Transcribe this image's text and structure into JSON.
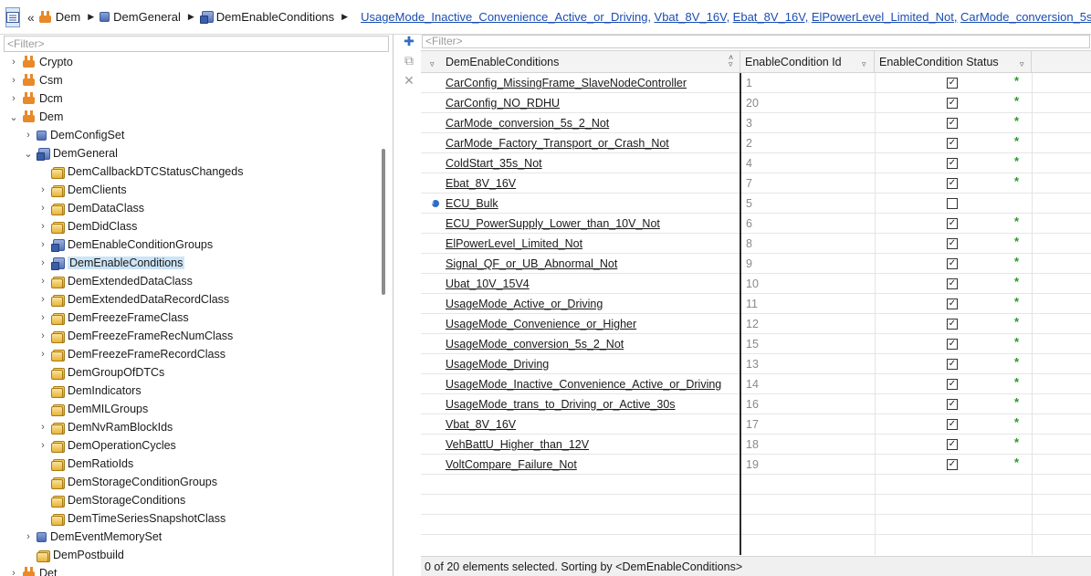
{
  "breadcrumb": {
    "back": "«",
    "segments": [
      "Dem",
      "DemGeneral",
      "DemEnableConditions"
    ],
    "links": [
      "UsageMode_Inactive_Convenience_Active_or_Driving,",
      "Vbat_8V_16V,",
      "Ebat_8V_16V,",
      "ElPowerLevel_Limited_Not,",
      "CarMode_conversion_5s_2_"
    ]
  },
  "tree": {
    "filter_placeholder": "<Filter>",
    "items": [
      {
        "label": "Crypto",
        "icon": "module-icon",
        "arrow": "›",
        "indent": 0
      },
      {
        "label": "Csm",
        "icon": "module-icon",
        "arrow": "›",
        "indent": 0
      },
      {
        "label": "Dcm",
        "icon": "module-icon",
        "arrow": "›",
        "indent": 0
      },
      {
        "label": "Dem",
        "icon": "module-icon",
        "arrow": "⌄",
        "indent": 0
      },
      {
        "label": "DemConfigSet",
        "icon": "container-icon",
        "arrow": "›",
        "indent": 1
      },
      {
        "label": "DemGeneral",
        "icon": "folder-lock-icon",
        "arrow": "⌄",
        "indent": 1
      },
      {
        "label": "DemCallbackDTCStatusChangeds",
        "icon": "folder-icon",
        "arrow": "",
        "indent": 2
      },
      {
        "label": "DemClients",
        "icon": "folder-icon",
        "arrow": "›",
        "indent": 2
      },
      {
        "label": "DemDataClass",
        "icon": "folder-icon",
        "arrow": "›",
        "indent": 2
      },
      {
        "label": "DemDidClass",
        "icon": "folder-icon",
        "arrow": "›",
        "indent": 2
      },
      {
        "label": "DemEnableConditionGroups",
        "icon": "folder-lock-icon",
        "arrow": "›",
        "indent": 2
      },
      {
        "label": "DemEnableConditions",
        "icon": "folder-lock-icon",
        "arrow": "›",
        "indent": 2,
        "selected": true
      },
      {
        "label": "DemExtendedDataClass",
        "icon": "folder-icon",
        "arrow": "›",
        "indent": 2
      },
      {
        "label": "DemExtendedDataRecordClass",
        "icon": "folder-icon",
        "arrow": "›",
        "indent": 2
      },
      {
        "label": "DemFreezeFrameClass",
        "icon": "folder-icon",
        "arrow": "›",
        "indent": 2
      },
      {
        "label": "DemFreezeFrameRecNumClass",
        "icon": "folder-icon",
        "arrow": "›",
        "indent": 2
      },
      {
        "label": "DemFreezeFrameRecordClass",
        "icon": "folder-icon",
        "arrow": "›",
        "indent": 2
      },
      {
        "label": "DemGroupOfDTCs",
        "icon": "folder-icon",
        "arrow": "",
        "indent": 2
      },
      {
        "label": "DemIndicators",
        "icon": "folder-icon",
        "arrow": "",
        "indent": 2
      },
      {
        "label": "DemMILGroups",
        "icon": "folder-icon",
        "arrow": "",
        "indent": 2
      },
      {
        "label": "DemNvRamBlockIds",
        "icon": "folder-icon",
        "arrow": "›",
        "indent": 2
      },
      {
        "label": "DemOperationCycles",
        "icon": "folder-icon",
        "arrow": "›",
        "indent": 2
      },
      {
        "label": "DemRatioIds",
        "icon": "folder-icon",
        "arrow": "",
        "indent": 2
      },
      {
        "label": "DemStorageConditionGroups",
        "icon": "folder-icon",
        "arrow": "",
        "indent": 2
      },
      {
        "label": "DemStorageConditions",
        "icon": "folder-icon",
        "arrow": "",
        "indent": 2
      },
      {
        "label": "DemTimeSeriesSnapshotClass",
        "icon": "folder-icon",
        "arrow": "",
        "indent": 2
      },
      {
        "label": "DemEventMemorySet",
        "icon": "container-icon",
        "arrow": "›",
        "indent": 1
      },
      {
        "label": "DemPostbuild",
        "icon": "folder-icon",
        "arrow": "",
        "indent": 1
      },
      {
        "label": "Det",
        "icon": "module-icon",
        "arrow": "›",
        "indent": 0
      }
    ]
  },
  "toolbar": {
    "add_icon": "add-icon",
    "duplicate_icon": "duplicate-icon",
    "delete_icon": "delete-icon"
  },
  "grid": {
    "filter_placeholder": "<Filter>",
    "columns": [
      "DemEnableConditions",
      "EnableCondition Id",
      "EnableCondition Status"
    ],
    "rows": [
      {
        "name": "CarConfig_MissingFrame_SlaveNodeController",
        "id": "1",
        "checked": true,
        "star": true
      },
      {
        "name": "CarConfig_NO_RDHU",
        "id": "20",
        "checked": true,
        "star": true
      },
      {
        "name": "CarMode_conversion_5s_2_Not",
        "id": "3",
        "checked": true,
        "star": true
      },
      {
        "name": "CarMode_Factory_Transport_or_Crash_Not",
        "id": "2",
        "checked": true,
        "star": true
      },
      {
        "name": "ColdStart_35s_Not",
        "id": "4",
        "checked": true,
        "star": true
      },
      {
        "name": "Ebat_8V_16V",
        "id": "7",
        "checked": true,
        "star": true
      },
      {
        "name": "ECU_Bulk",
        "id": "5",
        "checked": false,
        "star": false,
        "info": true
      },
      {
        "name": "ECU_PowerSupply_Lower_than_10V_Not",
        "id": "6",
        "checked": true,
        "star": true
      },
      {
        "name": "ElPowerLevel_Limited_Not",
        "id": "8",
        "checked": true,
        "star": true
      },
      {
        "name": "Signal_QF_or_UB_Abnormal_Not",
        "id": "9",
        "checked": true,
        "star": true
      },
      {
        "name": "Ubat_10V_15V4",
        "id": "10",
        "checked": true,
        "star": true
      },
      {
        "name": "UsageMode_Active_or_Driving",
        "id": "11",
        "checked": true,
        "star": true
      },
      {
        "name": "UsageMode_Convenience_or_Higher",
        "id": "12",
        "checked": true,
        "star": true
      },
      {
        "name": "UsageMode_conversion_5s_2_Not",
        "id": "15",
        "checked": true,
        "star": true
      },
      {
        "name": "UsageMode_Driving",
        "id": "13",
        "checked": true,
        "star": true
      },
      {
        "name": "UsageMode_Inactive_Convenience_Active_or_Driving",
        "id": "14",
        "checked": true,
        "star": true
      },
      {
        "name": "UsageMode_trans_to_Driving_or_Active_30s",
        "id": "16",
        "checked": true,
        "star": true
      },
      {
        "name": "Vbat_8V_16V",
        "id": "17",
        "checked": true,
        "star": true
      },
      {
        "name": "VehBattU_Higher_than_12V",
        "id": "18",
        "checked": true,
        "star": true
      },
      {
        "name": "VoltCompare_Failure_Not",
        "id": "19",
        "checked": true,
        "star": true
      }
    ]
  },
  "status": "0 of 20 elements selected. Sorting by <DemEnableConditions>"
}
